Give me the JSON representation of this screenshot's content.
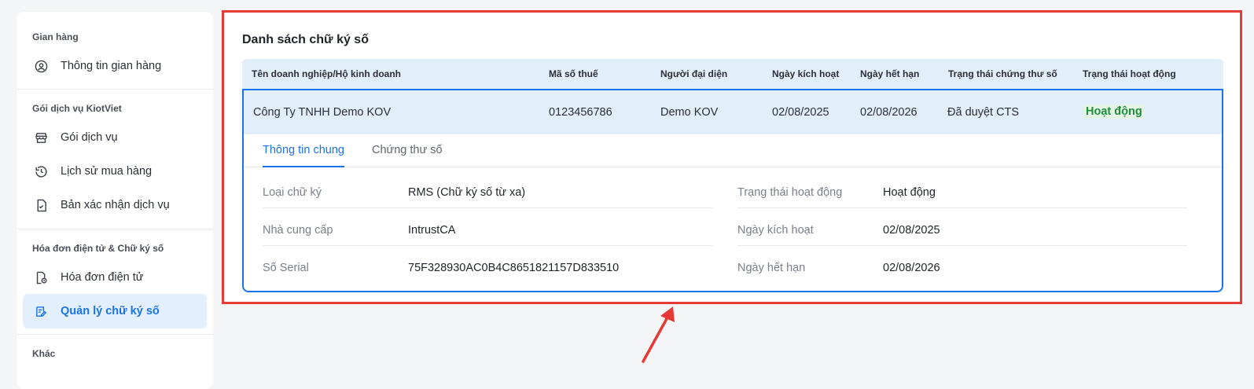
{
  "sidebar": {
    "groups": [
      {
        "title": "Gian hàng",
        "items": [
          {
            "label": "Thông tin gian hàng",
            "icon": "user-circle-icon"
          }
        ]
      },
      {
        "title": "Gói dịch vụ KiotViet",
        "items": [
          {
            "label": "Gói dịch vụ",
            "icon": "store-icon"
          },
          {
            "label": "Lịch sử mua hàng",
            "icon": "history-icon"
          },
          {
            "label": "Bản xác nhận dịch vụ",
            "icon": "document-check-icon"
          }
        ]
      },
      {
        "title": "Hóa đơn điện tử & Chữ ký số",
        "items": [
          {
            "label": "Hóa đơn điện tử",
            "icon": "invoice-icon"
          },
          {
            "label": "Quản lý chữ ký số",
            "icon": "signature-icon",
            "active": true
          }
        ]
      },
      {
        "title": "Khác",
        "items": []
      }
    ]
  },
  "main": {
    "title": "Danh sách chữ ký số",
    "columns": [
      "Tên doanh nghiệp/Hộ kinh doanh",
      "Mã số thuế",
      "Người đại diện",
      "Ngày kích hoạt",
      "Ngày hết hạn",
      "Trạng thái chứng thư số",
      "Trạng thái hoạt động"
    ],
    "row": {
      "name": "Công Ty TNHH Demo KOV",
      "tax_code": "0123456786",
      "representative": "Demo KOV",
      "activation_date": "02/08/2025",
      "expiry_date": "02/08/2026",
      "cert_status": "Đã duyệt CTS",
      "active_status": "Hoạt động"
    },
    "tabs": [
      {
        "label": "Thông tin chung",
        "active": true
      },
      {
        "label": "Chứng thư số",
        "active": false
      }
    ],
    "details_left": [
      {
        "label": "Loại chữ ký",
        "value": "RMS (Chữ ký số từ xa)"
      },
      {
        "label": "Nhà cung cấp",
        "value": "IntrustCA"
      },
      {
        "label": "Số Serial",
        "value": "75F328930AC0B4C8651821157D833510"
      }
    ],
    "details_right": [
      {
        "label": "Trạng thái hoạt động",
        "value": "Hoạt động"
      },
      {
        "label": "Ngày kích hoạt",
        "value": "02/08/2025"
      },
      {
        "label": "Ngày hết hạn",
        "value": "02/08/2026"
      }
    ]
  },
  "colors": {
    "accent": "#1a73e8",
    "highlight": "#e53935",
    "success": "#1e8e3e"
  }
}
